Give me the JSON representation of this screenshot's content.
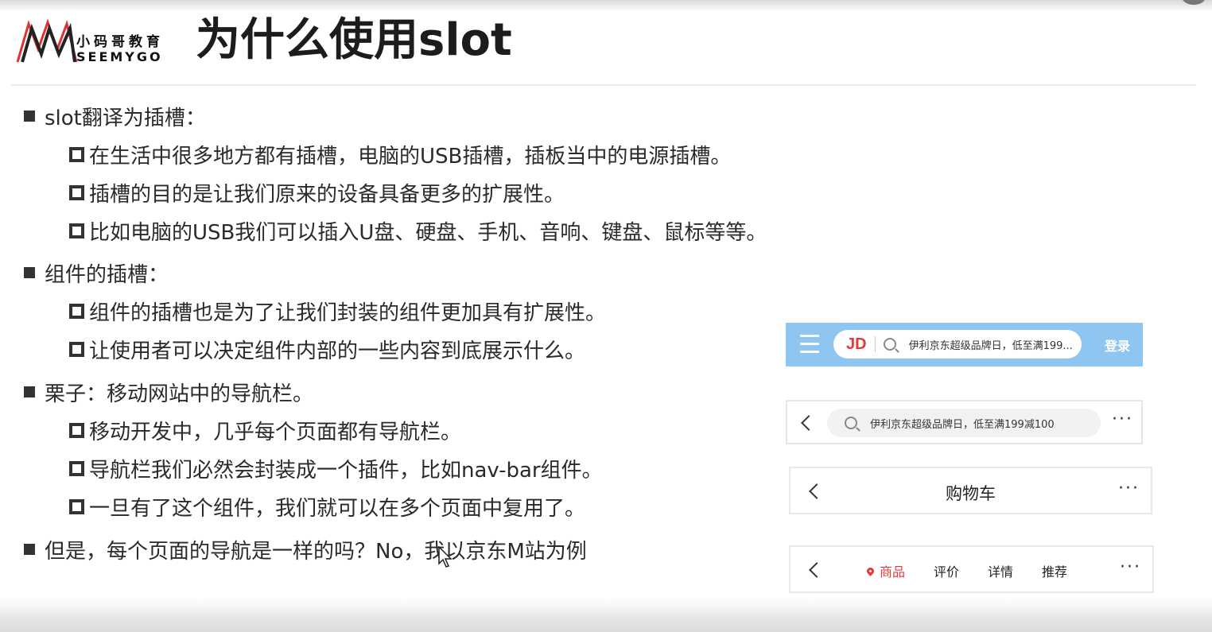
{
  "logo": {
    "cn": "小码哥教育",
    "en": "SEEMYGO"
  },
  "title": "为什么使用slot",
  "sections": [
    {
      "heading": "slot翻译为插槽：",
      "items": [
        "在生活中很多地方都有插槽，电脑的USB插槽，插板当中的电源插槽。",
        "插槽的目的是让我们原来的设备具备更多的扩展性。",
        "比如电脑的USB我们可以插入U盘、硬盘、手机、音响、键盘、鼠标等等。"
      ]
    },
    {
      "heading": "组件的插槽：",
      "items": [
        "组件的插槽也是为了让我们封装的组件更加具有扩展性。",
        "让使用者可以决定组件内部的一些内容到底展示什么。"
      ]
    },
    {
      "heading": "栗子：移动网站中的导航栏。",
      "items": [
        "移动开发中，几乎每个页面都有导航栏。",
        "导航栏我们必然会封装成一个插件，比如nav-bar组件。",
        "一旦有了这个组件，我们就可以在多个页面中复用了。"
      ]
    },
    {
      "heading": "但是，每个页面的导航是一样的吗？No，我以京东M站为例",
      "items": []
    }
  ],
  "navbars": {
    "home": {
      "logo": "JD",
      "placeholder": "伊利京东超级品牌日，低至满199...",
      "login": "登录"
    },
    "search": {
      "placeholder": "伊利京东超级品牌日，低至满199减100",
      "more": "···"
    },
    "cart": {
      "title": "购物车",
      "more": "···"
    },
    "product": {
      "tabs": [
        "商品",
        "评价",
        "详情",
        "推荐"
      ],
      "more": "···"
    }
  },
  "colors": {
    "jd_red": "#e4393c",
    "home_nav_bg": "#8ec5f1"
  }
}
